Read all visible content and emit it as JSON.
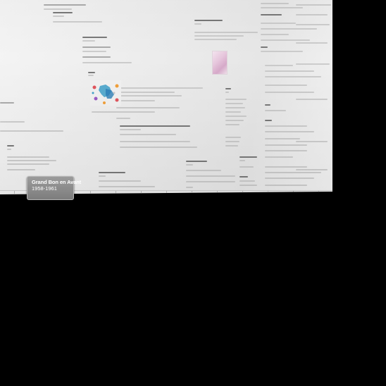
{
  "era_card": {
    "title": "Grand Bon en Avant",
    "years": "1958-1961"
  },
  "colors": {
    "background": "#000000",
    "panel": "#ececec",
    "card": "#8a8a8a",
    "card_text": "#ffffff"
  },
  "icons": {
    "map": "map-illustration-icon",
    "photo": "photo-thumbnail-icon"
  }
}
